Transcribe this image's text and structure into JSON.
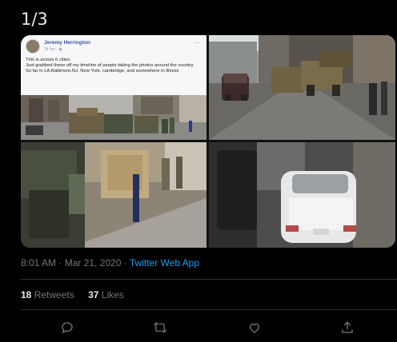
{
  "tweet": {
    "counter": "1/3",
    "timestamp": "8:01 AM · Mar 21, 2020 · ",
    "source_app": "Twitter Web App",
    "retweets_count": "18",
    "retweets_label": "Retweets",
    "likes_count": "37",
    "likes_label": "Likes"
  },
  "facebook_post": {
    "author": "Jeremy Herrington",
    "time": "14 hrs · ",
    "more": "···",
    "text": "This is across 6 cities.\nJust grabbed these off my timeline of people taking the photos around the country.\nSo far in LA,Baltimore,NJ, New York, cambridge, and somewhere in Illinois"
  },
  "actions": [
    {
      "icon": "reply-icon"
    },
    {
      "icon": "retweet-icon"
    },
    {
      "icon": "like-icon"
    },
    {
      "icon": "share-icon"
    }
  ],
  "colors": {
    "background": "#000000",
    "link": "#1d9bf0",
    "muted": "#6e767d",
    "divider": "#2f3336"
  }
}
